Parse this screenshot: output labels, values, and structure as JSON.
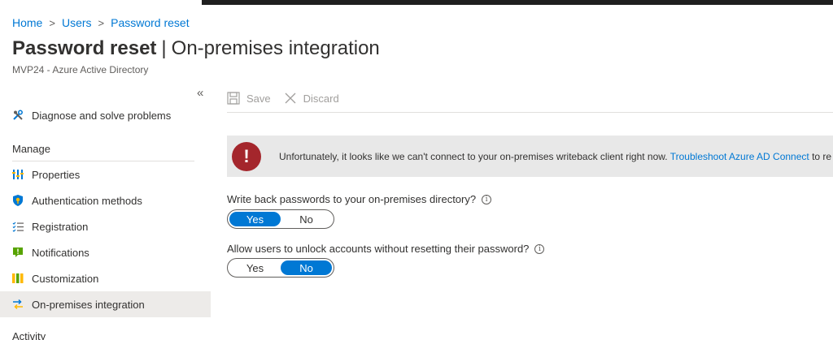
{
  "breadcrumb": {
    "home": "Home",
    "users": "Users",
    "current": "Password reset",
    "separator": ">"
  },
  "page": {
    "title_main": "Password reset",
    "title_separator": "|",
    "title_sub": "On-premises integration",
    "subtitle": "MVP24 - Azure Active Directory"
  },
  "sidebar": {
    "collapse_glyph": "«",
    "diagnose": "Diagnose and solve problems",
    "manage_header": "Manage",
    "items": [
      {
        "label": "Properties",
        "icon": "properties-icon"
      },
      {
        "label": "Authentication methods",
        "icon": "shield-icon"
      },
      {
        "label": "Registration",
        "icon": "list-icon"
      },
      {
        "label": "Notifications",
        "icon": "notification-icon"
      },
      {
        "label": "Customization",
        "icon": "customization-icon"
      },
      {
        "label": "On-premises integration",
        "icon": "sync-icon",
        "active": true
      }
    ],
    "activity_header": "Activity"
  },
  "toolbar": {
    "save": "Save",
    "discard": "Discard"
  },
  "alert": {
    "icon_glyph": "!",
    "message": "Unfortunately, it looks like we can't connect to your on-premises writeback client right now. ",
    "link": "Troubleshoot Azure AD Connect",
    "trailing": " to re"
  },
  "settings": {
    "writeback": {
      "label": "Write back passwords to your on-premises directory?",
      "info_glyph": "i",
      "yes": "Yes",
      "no": "No",
      "selected": "Yes"
    },
    "unlock": {
      "label": "Allow users to unlock accounts without resetting their password?",
      "info_glyph": "i",
      "yes": "Yes",
      "no": "No",
      "selected": "No"
    }
  },
  "colors": {
    "accent": "#0078d4",
    "error": "#a4262c",
    "active_nav": "#edebe9"
  }
}
